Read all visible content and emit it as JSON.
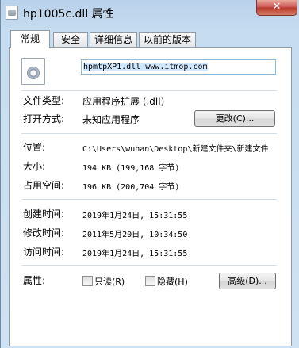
{
  "window": {
    "title": "hp1005c.dll 属性",
    "close_label": "✕"
  },
  "tabs": [
    {
      "label": "常规"
    },
    {
      "label": "安全"
    },
    {
      "label": "详细信息"
    },
    {
      "label": "以前的版本"
    }
  ],
  "general": {
    "file_name": "hpmtpXP1.dll  www.itmop.com",
    "file_type_label": "文件类型:",
    "file_type_value": "应用程序扩展 (.dll)",
    "open_with_label": "打开方式:",
    "open_with_value": "未知应用程序",
    "change_button": "更改(C)...",
    "location_label": "位置:",
    "location_value": "C:\\Users\\wuhan\\Desktop\\新建文件夹\\新建文件",
    "size_label": "大小:",
    "size_value": "194 KB (199,168 字节)",
    "size_on_disk_label": "占用空间:",
    "size_on_disk_value": "196 KB (200,704 字节)",
    "created_label": "创建时间:",
    "created_value": "2019年1月24日, 15:31:55",
    "modified_label": "修改时间:",
    "modified_value": "2011年5月20日, 10:34:50",
    "accessed_label": "访问时间:",
    "accessed_value": "2019年1月24日, 15:31:55",
    "attributes_label": "属性:",
    "readonly_label": "只读(R)",
    "hidden_label": "隐藏(H)",
    "advanced_button": "高级(D)..."
  }
}
